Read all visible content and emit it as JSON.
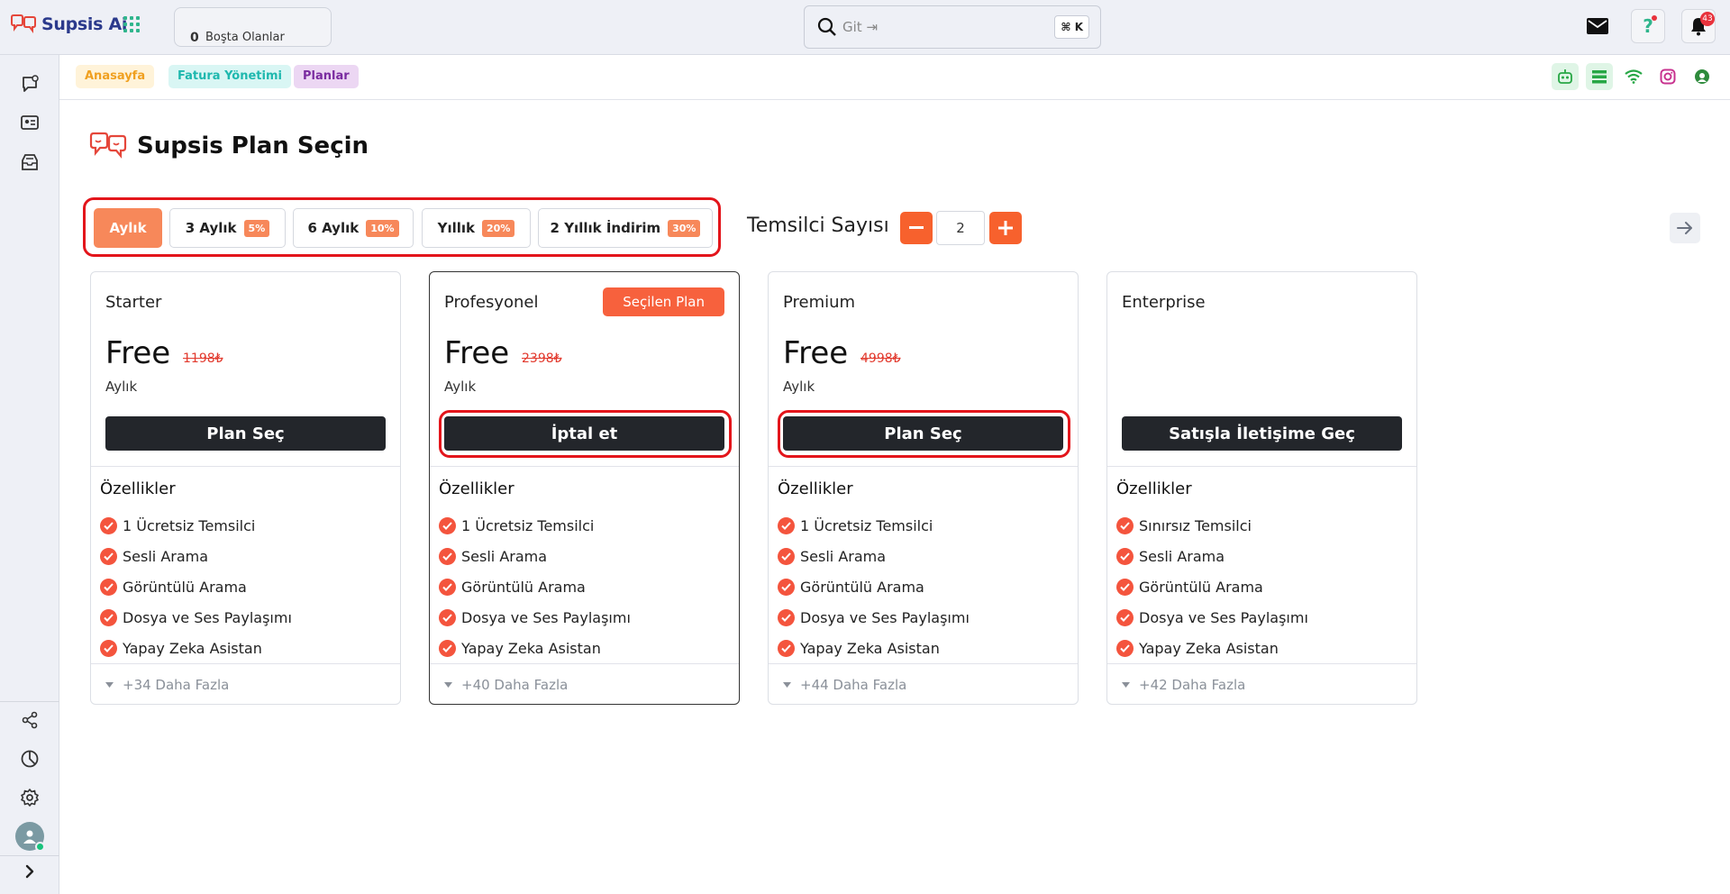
{
  "app": {
    "name": "Supsis Ai"
  },
  "topbar": {
    "idle_count": "0",
    "idle_label": "Boşta Olanlar",
    "search_placeholder": "Git ⇥",
    "search_shortcut": "⌘ K",
    "notification_count": "43"
  },
  "breadcrumbs": [
    "Anasayfa",
    "Fatura Yönetimi",
    "Planlar"
  ],
  "page": {
    "title": "Supsis Plan Seçin"
  },
  "periods": [
    {
      "label": "Aylık",
      "discount": "",
      "active": true
    },
    {
      "label": "3 Aylık",
      "discount": "5%"
    },
    {
      "label": "6 Aylık",
      "discount": "10%"
    },
    {
      "label": "Yıllık",
      "discount": "20%"
    },
    {
      "label": "2 Yıllık İndirim",
      "discount": "30%"
    }
  ],
  "representatives": {
    "label": "Temsilci Sayısı",
    "value": "2"
  },
  "plans": [
    {
      "name": "Starter",
      "price": "Free",
      "old_price": "1198₺",
      "period": "Aylık",
      "button": "Plan Seç",
      "features_title": "Özellikler",
      "features": [
        "1 Ücretsiz Temsilci",
        "Sesli Arama",
        "Görüntülü Arama",
        "Dosya ve Ses Paylaşımı",
        "Yapay Zeka Asistan"
      ],
      "more": "+34 Daha Fazla"
    },
    {
      "name": "Profesyonel",
      "selected_tag": "Seçilen Plan",
      "price": "Free",
      "old_price": "2398₺",
      "period": "Aylık",
      "button": "İptal et",
      "features_title": "Özellikler",
      "features": [
        "1 Ücretsiz Temsilci",
        "Sesli Arama",
        "Görüntülü Arama",
        "Dosya ve Ses Paylaşımı",
        "Yapay Zeka Asistan"
      ],
      "more": "+40 Daha Fazla"
    },
    {
      "name": "Premium",
      "price": "Free",
      "old_price": "4998₺",
      "period": "Aylık",
      "button": "Plan Seç",
      "features_title": "Özellikler",
      "features": [
        "1 Ücretsiz Temsilci",
        "Sesli Arama",
        "Görüntülü Arama",
        "Dosya ve Ses Paylaşımı",
        "Yapay Zeka Asistan"
      ],
      "more": "+44 Daha Fazla"
    },
    {
      "name": "Enterprise",
      "button": "Satışla İletişime Geç",
      "features_title": "Özellikler",
      "features": [
        "Sınırsız Temsilci",
        "Sesli Arama",
        "Görüntülü Arama",
        "Dosya ve Ses Paylaşımı",
        "Yapay Zeka Asistan"
      ],
      "more": "+42 Daha Fazla"
    }
  ],
  "colors": {
    "accent": "#f7885a",
    "brand": "#2b3a8c",
    "danger": "#e3151b"
  }
}
